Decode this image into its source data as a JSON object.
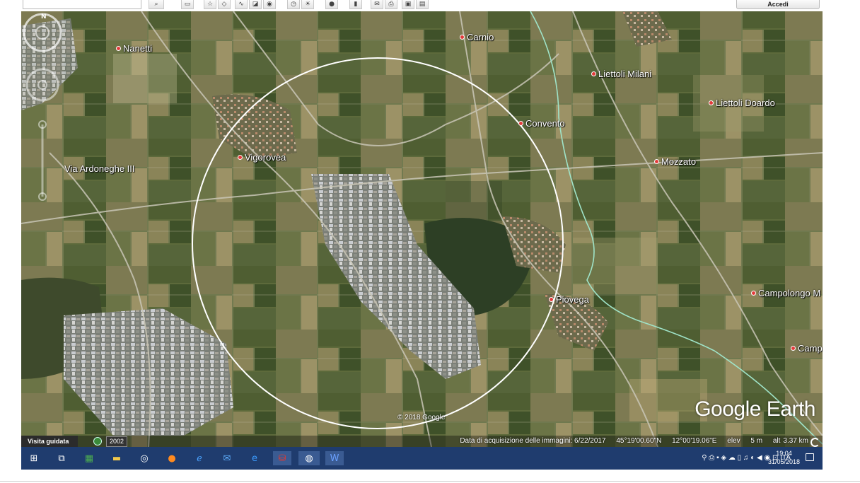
{
  "toolbar": {
    "login_label": "Accedi",
    "icons": [
      "search-icon",
      "sidebar-icon",
      "placemark-icon",
      "polygon-icon",
      "path-icon",
      "overlay-icon",
      "tour-icon",
      "history-icon",
      "sun-icon",
      "planets-icon",
      "ruler-icon",
      "email-icon",
      "print-icon",
      "save-image-icon",
      "maps-icon"
    ]
  },
  "map": {
    "places": [
      {
        "name": "Nanetti"
      },
      {
        "name": "Carnio"
      },
      {
        "name": "Liettoli Milani"
      },
      {
        "name": "Liettoli Doardo"
      },
      {
        "name": "Convento"
      },
      {
        "name": "Vigorovea"
      },
      {
        "name": "Mozzato"
      },
      {
        "name": "Piovega"
      },
      {
        "name": "Campolongo M"
      },
      {
        "name": "Camp"
      }
    ],
    "road_label": "Via Ardoneghe III",
    "copyright": "© 2018 Google",
    "logo": "Google Earth",
    "colors": {
      "circle": "#ffffff",
      "boundary": "#9fe3c8",
      "pin": "#e23a3a"
    }
  },
  "statusbar": {
    "tour_label": "Visita guidata",
    "year": "2002",
    "acquisition": "Data di acquisizione delle immagini: 6/22/2017",
    "lat": "45°19'00.60\"N",
    "lon": "12°00'19.06\"E",
    "elev_label": "elev",
    "elev_value": "5 m",
    "alt_label": "alt",
    "alt_value": "3.37 km"
  },
  "taskbar": {
    "language": "ITA",
    "time": "19:04",
    "date": "31/05/2018",
    "apps": [
      "windows-start-icon",
      "task-view-icon",
      "spreadsheet-icon",
      "file-explorer-icon",
      "settings-icon",
      "firefox-icon",
      "internet-explorer-icon",
      "mail-icon",
      "edge-icon",
      "acrobat-icon",
      "google-earth-icon",
      "word-icon"
    ]
  }
}
